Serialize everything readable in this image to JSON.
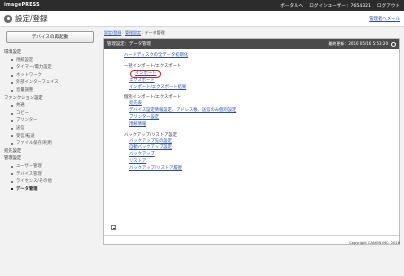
{
  "topbar": {
    "logo_prefix": "image",
    "logo_main": "PRESS",
    "portal": "ポータルへ",
    "user_label": "ログインユーザー：",
    "user_id": "7654321",
    "logout": "ログアウト"
  },
  "header": {
    "title": "設定/登録",
    "admin_link": "管理者へメール"
  },
  "sidebar": {
    "restart_button": "デバイスの再起動",
    "sections": [
      {
        "label": "環境設定",
        "items": [
          "用紙設定",
          "タイマー/電力設定",
          "ネットワーク",
          "外部インターフェイス",
          "音量調整"
        ]
      },
      {
        "label": "ファンクション設定",
        "items": [
          "共通",
          "コピー",
          "プリンター",
          "送信",
          "受信/転送",
          "ファイル保存/利用"
        ]
      },
      {
        "label": "宛先設定",
        "items": []
      },
      {
        "label": "管理設定",
        "items": [
          "ユーザー管理",
          "デバイス管理",
          "ライセンス/その他",
          "データ管理"
        ]
      }
    ],
    "active_item": "データ管理"
  },
  "breadcrumb": [
    "設定/登録",
    "管理設定",
    "データ管理"
  ],
  "panel": {
    "title": "管理設定：データ管理",
    "last_updated": "最終更新：2016 05/16 5:53:20"
  },
  "content": {
    "hdd_link": "ハードディスクの全データ初期化",
    "groups": [
      {
        "label": "一括インポート/エクスポート",
        "links": [
          "インポート",
          "エクスポート",
          "インポート/エクスポート結果"
        ]
      },
      {
        "label": "個別インポート/エクスポート",
        "links": [
          "宛先表",
          "デバイス設定情報設定、アドレス帳、送信のみ個別設定",
          "プリンター設定",
          "用紙情報"
        ]
      },
      {
        "label": "バックアップ/リストア設定",
        "links": [
          "バックアップ先の設定",
          "自動バックアップ設定",
          "バックアップ",
          "リストア",
          "バックアップ/リストア履歴"
        ]
      }
    ],
    "highlighted_link": "インポート"
  },
  "footer": {
    "copyright": "Copyright CANON INC. 2016"
  },
  "colors": {
    "topbar": "#2c2c2c",
    "panel_header": "#4a4a4a",
    "link": "#2a4fa0",
    "highlight": "#d42020"
  }
}
